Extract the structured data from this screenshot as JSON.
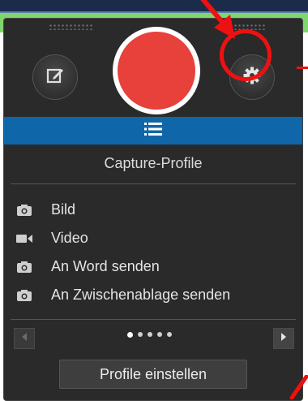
{
  "colors": {
    "panel_bg": "#2a2a2a",
    "accent_blue": "#0f67a9",
    "record_red": "#e8403a",
    "annotation_red": "#ee1111",
    "top_green": "#7fd66a"
  },
  "toolbar": {
    "edit_icon": "edit-icon",
    "record_icon": "record-icon",
    "settings_icon": "gear-icon"
  },
  "tab": {
    "icon": "list-icon"
  },
  "section": {
    "title": "Capture-Profile"
  },
  "profiles": [
    {
      "label": "Bild",
      "icon": "camera-icon"
    },
    {
      "label": "Video",
      "icon": "video-camera-icon"
    },
    {
      "label": "An Word senden",
      "icon": "camera-icon"
    },
    {
      "label": "An Zwischenablage senden",
      "icon": "camera-icon"
    }
  ],
  "pager": {
    "pages": 5,
    "current": 1
  },
  "footer": {
    "button_label": "Profile einstellen"
  }
}
